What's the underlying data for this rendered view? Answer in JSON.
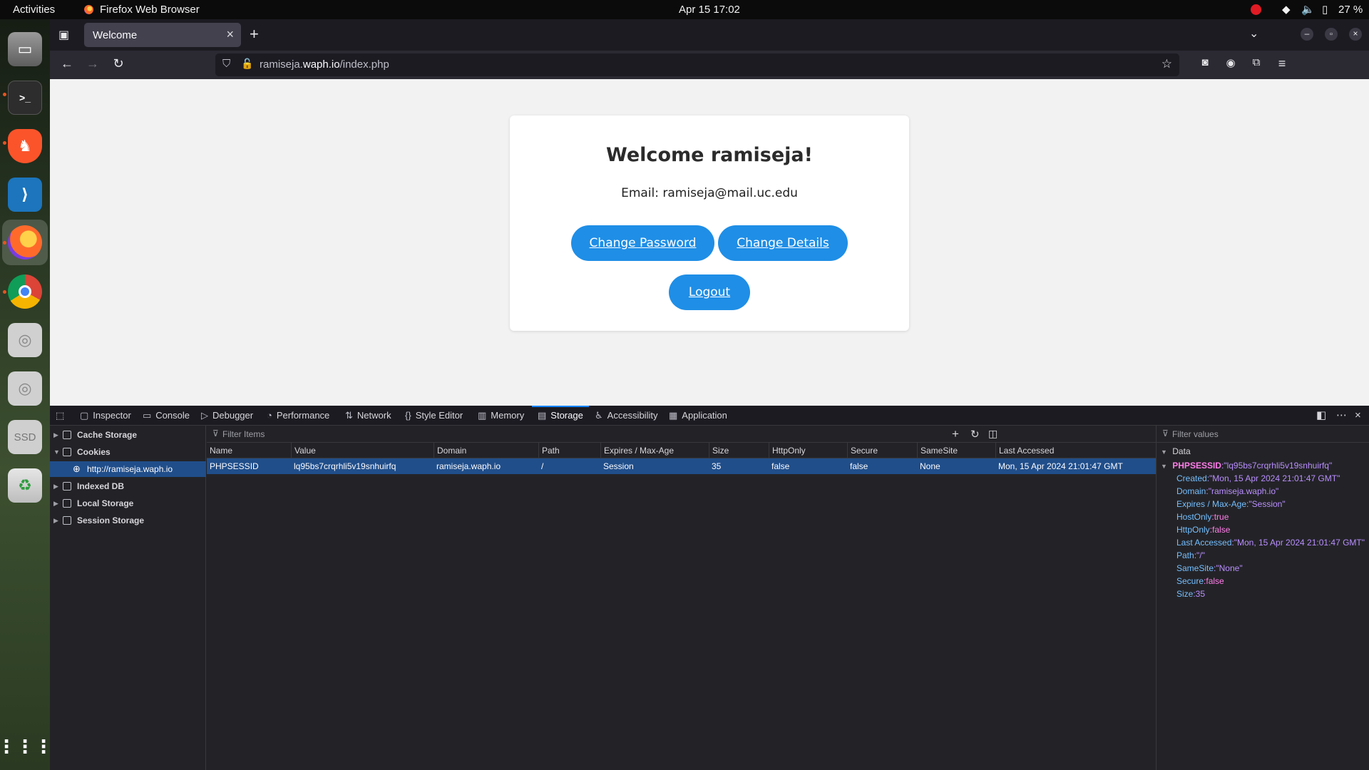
{
  "topbar": {
    "activities": "Activities",
    "app_name": "Firefox Web Browser",
    "clock": "Apr 15  17:02",
    "battery": "27 %"
  },
  "browser": {
    "tab_title": "Welcome",
    "url_host": "ramiseja.",
    "url_domain": "waph.io",
    "url_path": "/index.php"
  },
  "page": {
    "heading": "Welcome ramiseja!",
    "email_line": "Email: ramiseja@mail.uc.edu",
    "change_password": "Change Password",
    "change_details": "Change Details",
    "logout": "Logout"
  },
  "devtools": {
    "tabs": [
      "Inspector",
      "Console",
      "Debugger",
      "Performance",
      "Network",
      "Style Editor",
      "Memory",
      "Storage",
      "Accessibility",
      "Application"
    ],
    "active_tab": "Storage",
    "tree": {
      "cache_storage": "Cache Storage",
      "cookies": "Cookies",
      "cookie_host": "http://ramiseja.waph.io",
      "indexed_db": "Indexed DB",
      "local_storage": "Local Storage",
      "session_storage": "Session Storage"
    },
    "filter_items_placeholder": "Filter Items",
    "filter_values_placeholder": "Filter values",
    "columns": [
      "Name",
      "Value",
      "Domain",
      "Path",
      "Expires / Max-Age",
      "Size",
      "HttpOnly",
      "Secure",
      "SameSite",
      "Last Accessed"
    ],
    "cookie_row": [
      "PHPSESSID",
      "lq95bs7crqrhli5v19snhuirfq",
      "ramiseja.waph.io",
      "/",
      "Session",
      "35",
      "false",
      "false",
      "None",
      "Mon, 15 Apr 2024 21:01:47 GMT"
    ],
    "sidebar": {
      "section": "Data",
      "root_key": "PHPSESSID",
      "root_value": ":\"lq95bs7crqrhli5v19snhuirfq\"",
      "entries": [
        {
          "key": "Created",
          "value": ":\"Mon, 15 Apr 2024 21:01:47 GMT\""
        },
        {
          "key": "Domain",
          "value": ":\"ramiseja.waph.io\""
        },
        {
          "key": "Expires / Max-Age",
          "value": ":\"Session\""
        },
        {
          "key": "HostOnly",
          "value": ":true"
        },
        {
          "key": "HttpOnly",
          "value": ":false"
        },
        {
          "key": "Last Accessed",
          "value": ":\"Mon, 15 Apr 2024 21:01:47 GMT\""
        },
        {
          "key": "Path",
          "value": ":\"/\""
        },
        {
          "key": "SameSite",
          "value": ":\"None\""
        },
        {
          "key": "Secure",
          "value": ":false"
        },
        {
          "key": "Size",
          "value": ":35"
        }
      ]
    }
  },
  "colors": {
    "button_blue": "#1f8ee6",
    "selection_blue": "#204e8a",
    "accent": "#0a84ff"
  }
}
